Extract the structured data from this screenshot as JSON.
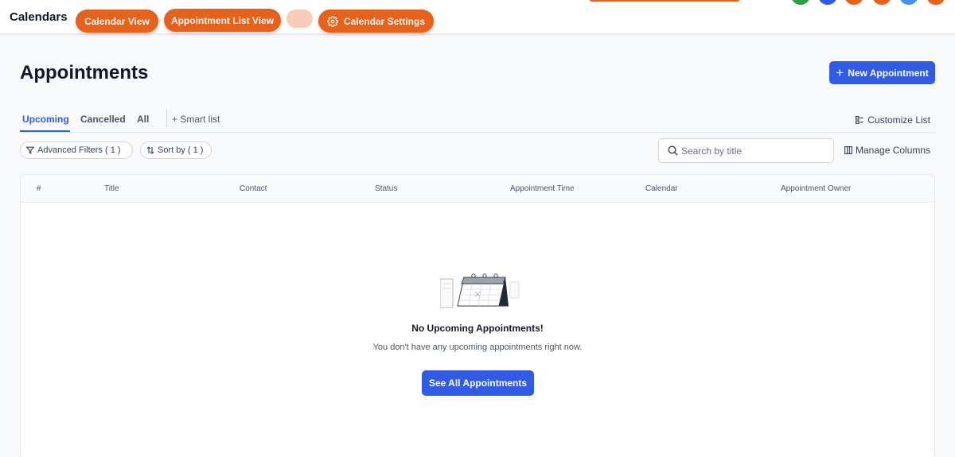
{
  "app": {
    "title": "Calendars"
  },
  "topnav": {
    "calendar_view": "Calendar View",
    "appointment_list_view": "Appointment List View",
    "calendar_settings": "Calendar Settings"
  },
  "header": {
    "title": "Appointments",
    "new_button": "New Appointment"
  },
  "tabs": {
    "items": [
      {
        "label": "Upcoming",
        "active": true
      },
      {
        "label": "Cancelled",
        "active": false
      },
      {
        "label": "All",
        "active": false
      }
    ],
    "smart_list": "Smart list",
    "customize": "Customize List"
  },
  "filters": {
    "advanced": "Advanced Filters ( 1 )",
    "sort": "Sort by ( 1 )",
    "search_placeholder": "Search by title",
    "manage_columns": "Manage Columns"
  },
  "table": {
    "columns": [
      "#",
      "Title",
      "Contact",
      "Status",
      "Appointment Time",
      "Calendar",
      "Appointment Owner"
    ]
  },
  "empty_state": {
    "title": "No Upcoming Appointments!",
    "subtitle": "You don't have any upcoming appointments right now.",
    "button": "See All Appointments"
  },
  "colors": {
    "accent_orange": "#e8611a",
    "primary_blue": "#2f5be7",
    "status_dots": [
      "#2f9e44",
      "#2f5be7",
      "#e8611a",
      "#e8611a",
      "#4a8ef0",
      "#e8611a"
    ]
  }
}
